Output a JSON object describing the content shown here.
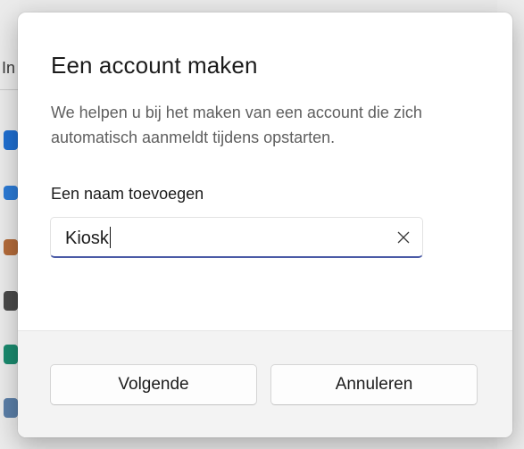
{
  "background": {
    "tab_fragment": "In"
  },
  "dialog": {
    "title": "Een account maken",
    "description": "We helpen u bij het maken van een account die zich automatisch aanmeldt tijdens opstarten.",
    "field_label": "Een naam toevoegen",
    "name_value": "Kiosk",
    "clear_icon": "close-icon",
    "buttons": {
      "next": "Volgende",
      "cancel": "Annuleren"
    }
  },
  "colors": {
    "accent": "#4a5aa6",
    "dialog_bg": "#ffffff",
    "footer_bg": "#f3f3f3"
  }
}
